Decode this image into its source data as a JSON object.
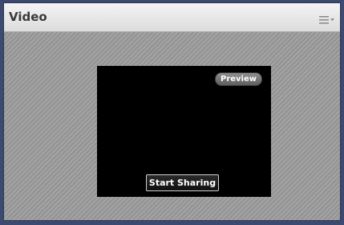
{
  "pod": {
    "title": "Video",
    "menu_icon": "hamburger-menu-icon"
  },
  "video": {
    "preview_label": "Preview",
    "start_sharing_label": "Start Sharing"
  }
}
